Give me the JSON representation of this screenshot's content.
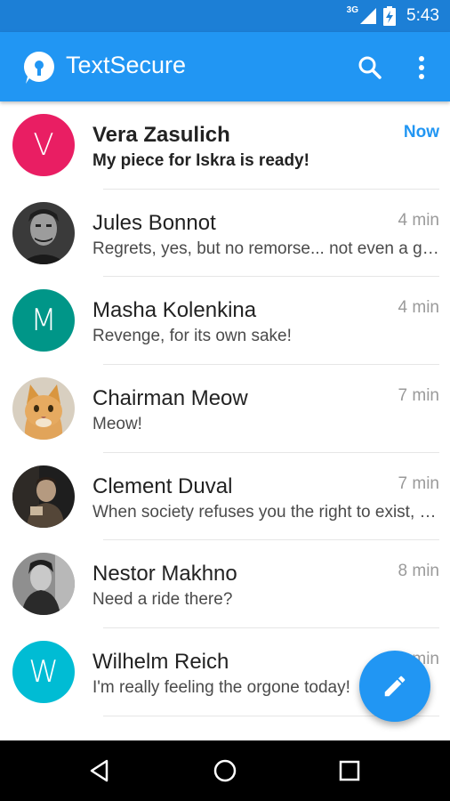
{
  "status_bar": {
    "network": "3G",
    "time": "5:43"
  },
  "app_bar": {
    "title": "TextSecure",
    "icons": [
      "search-icon",
      "overflow-menu-icon"
    ]
  },
  "conversations": [
    {
      "name": "Vera Zasulich",
      "snippet": "My piece for Iskra is ready!",
      "time": "Now",
      "unread": true,
      "avatar": {
        "type": "initial",
        "initial": "V",
        "color": "#e91e63"
      }
    },
    {
      "name": "Jules Bonnot",
      "snippet": "Regrets, yes, but no remorse... not even a glimmer",
      "time": "4 min",
      "unread": false,
      "avatar": {
        "type": "photo"
      }
    },
    {
      "name": "Masha Kolenkina",
      "snippet": "Revenge, for its own sake!",
      "time": "4 min",
      "unread": false,
      "avatar": {
        "type": "initial",
        "initial": "M",
        "color": "#009688"
      }
    },
    {
      "name": "Chairman Meow",
      "snippet": "Meow!",
      "time": "7 min",
      "unread": false,
      "avatar": {
        "type": "photo"
      }
    },
    {
      "name": "Clement Duval",
      "snippet": "When society refuses you the right to exist, you must take it",
      "time": "7 min",
      "unread": false,
      "avatar": {
        "type": "photo"
      }
    },
    {
      "name": "Nestor Makhno",
      "snippet": "Need a ride there?",
      "time": "8 min",
      "unread": false,
      "avatar": {
        "type": "photo"
      }
    },
    {
      "name": "Wilhelm Reich",
      "snippet": "I'm really feeling the orgone today!",
      "time": "9 min",
      "unread": false,
      "avatar": {
        "type": "initial",
        "initial": "W",
        "color": "#00bcd4"
      }
    }
  ],
  "fab": {
    "icon": "pencil-icon"
  },
  "nav_bar": {
    "icons": [
      "back-icon",
      "home-icon",
      "recents-icon"
    ]
  },
  "colors": {
    "primary": "#2196f3",
    "primary_dark": "#1c7fd6",
    "unread_time": "#2196f3"
  }
}
